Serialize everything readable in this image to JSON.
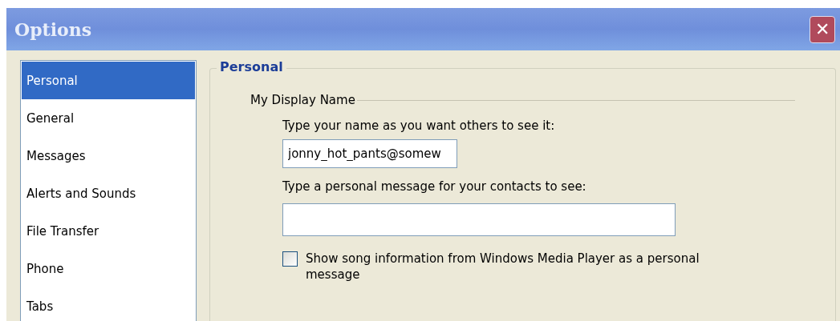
{
  "window": {
    "title": "Options",
    "close": "✕"
  },
  "sidebar": {
    "items": [
      {
        "label": "Personal",
        "selected": true
      },
      {
        "label": "General",
        "selected": false
      },
      {
        "label": "Messages",
        "selected": false
      },
      {
        "label": "Alerts and Sounds",
        "selected": false
      },
      {
        "label": "File Transfer",
        "selected": false
      },
      {
        "label": "Phone",
        "selected": false
      },
      {
        "label": "Tabs",
        "selected": false
      }
    ]
  },
  "panel": {
    "title": "Personal",
    "section": "My Display Name",
    "name_label": "Type your name as you want others to see it:",
    "name_value": "jonny_hot_pants@somew",
    "message_label": "Type a personal message for your contacts to see:",
    "song_option": {
      "label": "Show song information from Windows Media Player as a personal message",
      "checked": false
    }
  }
}
